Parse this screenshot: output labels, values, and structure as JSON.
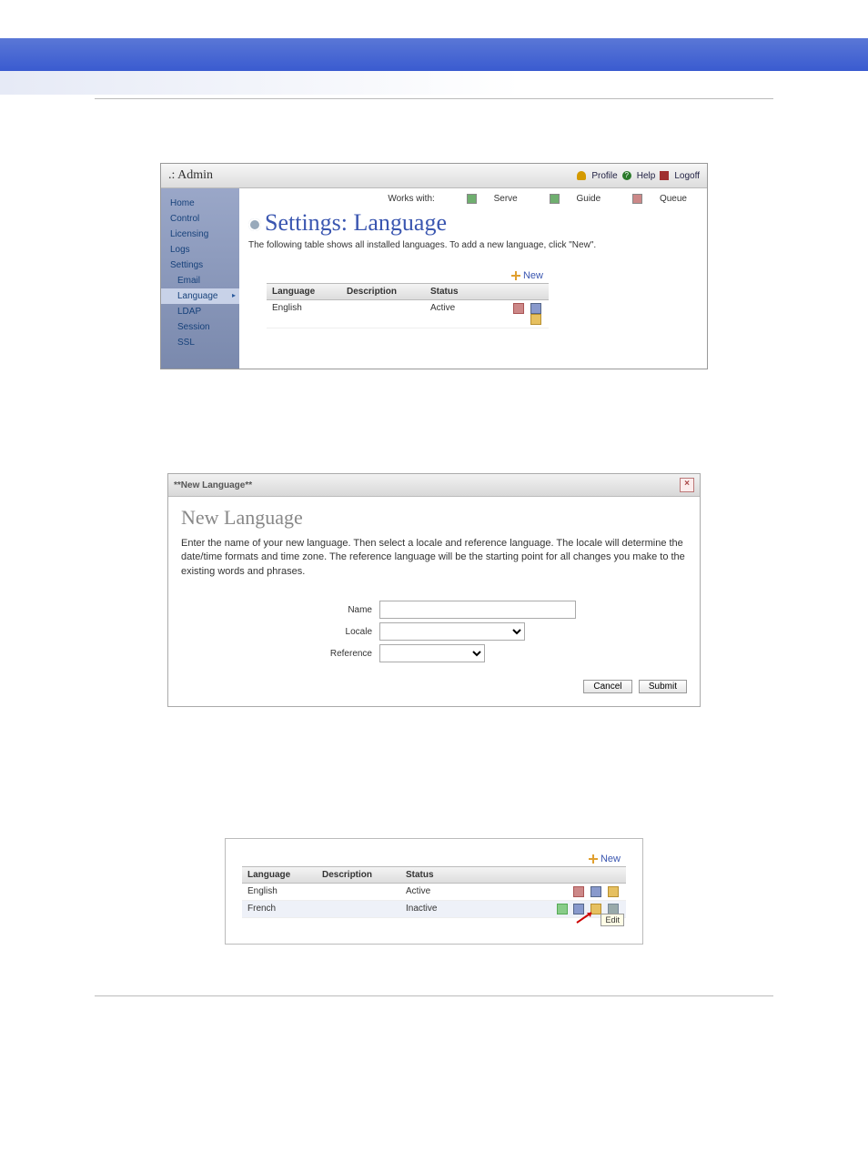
{
  "shot1": {
    "admin_title": ".: Admin",
    "profile": "Profile",
    "help": "Help",
    "logoff": "Logoff",
    "works_with": "Works with:",
    "serve": "Serve",
    "guide": "Guide",
    "queue": "Queue",
    "nav": {
      "home": "Home",
      "control": "Control",
      "licensing": "Licensing",
      "logs": "Logs",
      "settings": "Settings",
      "email": "Email",
      "language": "Language",
      "ldap": "LDAP",
      "session": "Session",
      "ssl": "SSL"
    },
    "page_title": "Settings: Language",
    "page_sub": "The following table shows all installed languages. To add a new language, click \"New\".",
    "new_label": "New",
    "cols": {
      "lang": "Language",
      "desc": "Description",
      "stat": "Status"
    },
    "rows": [
      {
        "lang": "English",
        "desc": "",
        "stat": "Active"
      }
    ]
  },
  "dlg": {
    "bar": "**New Language**",
    "heading": "New Language",
    "para": "Enter the name of your new language. Then select a locale and reference language. The locale will determine the date/time formats and time zone. The reference language will be the starting point for all changes you make to the existing words and phrases.",
    "name_lbl": "Name",
    "locale_lbl": "Locale",
    "ref_lbl": "Reference",
    "cancel": "Cancel",
    "submit": "Submit"
  },
  "shot3": {
    "new_label": "New",
    "cols": {
      "lang": "Language",
      "desc": "Description",
      "stat": "Status"
    },
    "rows": [
      {
        "lang": "English",
        "desc": "",
        "stat": "Active"
      },
      {
        "lang": "French",
        "desc": "",
        "stat": "Inactive"
      }
    ],
    "tooltip": "Edit"
  }
}
